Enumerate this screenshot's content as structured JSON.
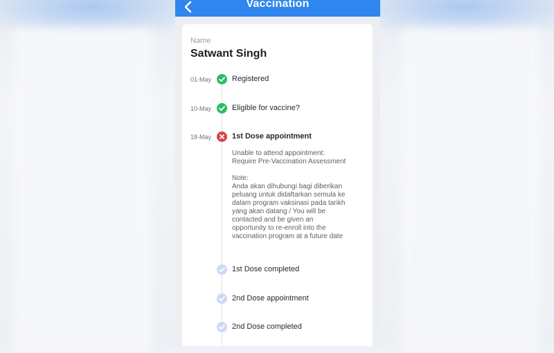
{
  "header": {
    "title": "Vaccination"
  },
  "profile": {
    "name_label": "Name",
    "name_value": "Satwant Singh"
  },
  "timeline": [
    {
      "date": "01-May",
      "label": "Registered",
      "status": "done"
    },
    {
      "date": "10-May",
      "label": "Eligible for vaccine?",
      "status": "done"
    },
    {
      "date": "18-May",
      "label": "1st Dose appointment",
      "status": "failed",
      "detail": "Unable to attend appointment:\nRequire Pre-Vaccination Assessment",
      "note": "Note:\nAnda akan dihubungi bagi diberikan\npeluang untuk didaftarkan semula ke\ndalam program vaksinasi pada tarikh\nyang akan datang / You will be\ncontacted and be given an\nopportunity to re-enroll into the\nvaccination program at a future date"
    },
    {
      "date": "",
      "label": "1st Dose completed",
      "status": "pending"
    },
    {
      "date": "",
      "label": "2nd Dose appointment",
      "status": "pending"
    },
    {
      "date": "",
      "label": "2nd Dose completed",
      "status": "pending"
    }
  ],
  "colors": {
    "header": "#2f86ee",
    "done": "#2bbd62",
    "failed": "#d94343",
    "pending": "#c9daf2"
  },
  "icons": {
    "back": "chevron-left-icon",
    "done": "check-circle-icon",
    "failed": "x-circle-icon",
    "pending": "check-circle-icon"
  }
}
